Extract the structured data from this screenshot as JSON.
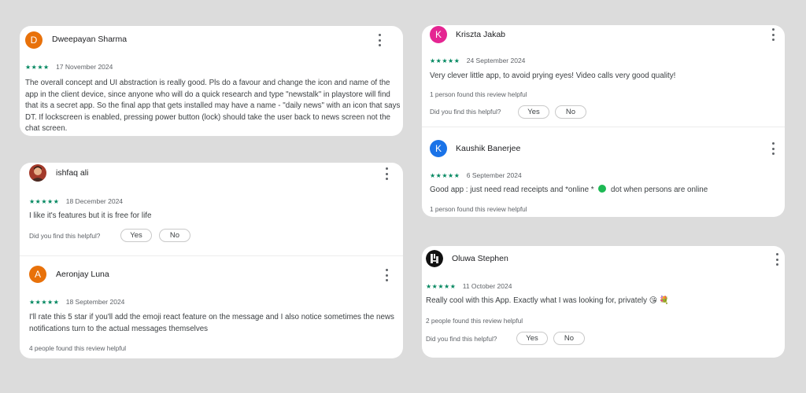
{
  "reviews": [
    {
      "author": "Dweepayan Sharma",
      "avatar_letter": "D",
      "avatar_color": "#e8710a",
      "rating": 4,
      "stars": "★★★★",
      "date": "17 November 2024",
      "text": "The overall concept and UI abstraction is really good. Pls do a favour and change the icon and name of the app in the client device, since anyone who will do a quick research and type \"newstalk\" in playstore will find that its a secret app. So the final app that gets installed may have a name - \"daily news\" with an icon that says DT. If lockscreen is enabled, pressing power button (lock) should take the user back to news screen not the chat screen."
    },
    {
      "author": "ishfaq ali",
      "avatar_icon": "profile-photo",
      "rating": 5,
      "stars": "★★★★★",
      "date": "18 December 2024",
      "text": "I like it's features but it is free for life",
      "helpful_question": "Did you find this helpful?",
      "yes_label": "Yes",
      "no_label": "No"
    },
    {
      "author": "Aeronjay Luna",
      "avatar_letter": "A",
      "avatar_color": "#e8710a",
      "rating": 5,
      "stars": "★★★★★",
      "date": "18 September 2024",
      "text": "I'll rate this 5 star if you'll add the emoji react feature on the message and I also notice sometimes the news notifications turn to the actual messages themselves",
      "helpful_count_text": "4 people found this review helpful"
    },
    {
      "author": "Kriszta Jakab",
      "avatar_letter": "K",
      "avatar_color": "#e52592",
      "rating": 5,
      "stars": "★★★★★",
      "date": "24 September 2024",
      "text": "Very clever little app, to avoid prying eyes! Video calls very good quality!",
      "helpful_count_text": "1 person found this review helpful",
      "helpful_question": "Did you find this helpful?",
      "yes_label": "Yes",
      "no_label": "No"
    },
    {
      "author": "Kaushik Banerjee",
      "avatar_letter": "K",
      "avatar_color": "#1a73e8",
      "rating": 5,
      "stars": "★★★★★",
      "date": "6 September 2024",
      "text_before": "Good app : just need read receipts and *online * ",
      "text_after": " dot when persons are online",
      "helpful_count_text": "1 person found this review helpful"
    },
    {
      "author": "Oluwa Stephen",
      "avatar_icon": "profile-photo",
      "rating": 5,
      "stars": "★★★★★",
      "date": "11 October 2024",
      "text": "Really cool with this App. Exactly what I was looking for, privately 😘 💐",
      "helpful_count_text": "2 people found this review helpful",
      "helpful_question": "Did you find this helpful?",
      "yes_label": "Yes",
      "no_label": "No"
    }
  ],
  "colors": {
    "background": "#dcdcdc",
    "card": "#ffffff",
    "star": "#01875f",
    "online_dot": "#1db954"
  }
}
